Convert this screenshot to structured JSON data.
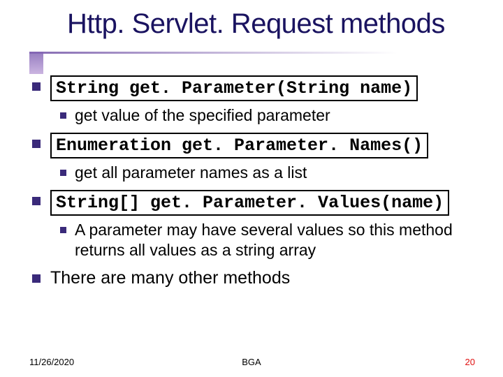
{
  "title": "Http. Servlet. Request methods",
  "items": [
    {
      "code": "String get. Parameter(String name)",
      "sub": "get value of the specified parameter"
    },
    {
      "code": "Enumeration get. Parameter. Names()",
      "sub": "get all parameter names as a list"
    },
    {
      "code": "String[] get. Parameter. Values(name)",
      "sub": "A parameter may have several values so this method returns all values as a string array"
    },
    {
      "text": "There are many other methods"
    }
  ],
  "footer": {
    "date": "11/26/2020",
    "center": "BGA",
    "page": "20"
  }
}
